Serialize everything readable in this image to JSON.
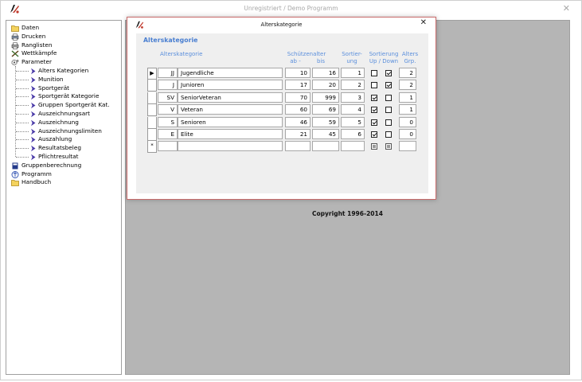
{
  "app": {
    "title": "Unregistriert  /  Demo Programm",
    "close_glyph": "✕"
  },
  "tree": {
    "items": [
      {
        "label": "Daten",
        "icon": "folder-icon",
        "level": 0
      },
      {
        "label": "Drucken",
        "icon": "print-icon",
        "level": 0
      },
      {
        "label": "Ranglisten",
        "icon": "printer-icon",
        "level": 0
      },
      {
        "label": "Wettkämpfe",
        "icon": "crossed-rifles-icon",
        "level": 0
      },
      {
        "label": "Parameter",
        "icon": "gears-icon",
        "level": 0
      },
      {
        "label": "Alters Kategorien",
        "icon": "arrow-icon",
        "level": 1
      },
      {
        "label": "Munition",
        "icon": "arrow-icon",
        "level": 1
      },
      {
        "label": "Sportgerät",
        "icon": "arrow-icon",
        "level": 1
      },
      {
        "label": "Sportgerät Kategorie",
        "icon": "arrow-icon",
        "level": 1
      },
      {
        "label": "Gruppen Sportgerät Kat.",
        "icon": "arrow-icon",
        "level": 1
      },
      {
        "label": "Auszeichnungsart",
        "icon": "arrow-icon",
        "level": 1
      },
      {
        "label": "Auszeichnung",
        "icon": "arrow-icon",
        "level": 1
      },
      {
        "label": "Auszeichnungslimiten",
        "icon": "arrow-icon",
        "level": 1
      },
      {
        "label": "Auszahlung",
        "icon": "arrow-icon",
        "level": 1
      },
      {
        "label": "Resultatsbeleg",
        "icon": "arrow-icon",
        "level": 1
      },
      {
        "label": "Pflichtresultat",
        "icon": "arrow-icon",
        "level": 1
      },
      {
        "label": "Gruppenberechnung",
        "icon": "book-icon",
        "level": 0
      },
      {
        "label": "Programm",
        "icon": "info-icon",
        "level": 0
      },
      {
        "label": "Handbuch",
        "icon": "folder-icon",
        "level": 0
      }
    ]
  },
  "workspace": {
    "copyright": "Copyright  1996-2014"
  },
  "dialog": {
    "title": "Alterskategorie",
    "close_glyph": "✕",
    "section_title": "Alterskategorie",
    "headers": {
      "kategorie": "Alterskategorie",
      "schuetzenalter_line1": "Schützenalter",
      "ab": "ab  -",
      "bis": "bis",
      "sortierung_line1": "Sortier-",
      "sortierung_line2": "ung",
      "updown_line1": "Sortierung",
      "updown_line2": "Up / Down",
      "grp_line1": "Alters",
      "grp_line2": "Grp."
    },
    "current_row_marker": "▶",
    "new_row_marker": "*",
    "rows": [
      {
        "code": "JJ",
        "name": "Jugendliche",
        "ab": "10",
        "bis": "16",
        "sort": "1",
        "up": false,
        "down": true,
        "grp": "2"
      },
      {
        "code": "J",
        "name": "Junioren",
        "ab": "17",
        "bis": "20",
        "sort": "2",
        "up": false,
        "down": true,
        "grp": "2"
      },
      {
        "code": "SV",
        "name": "SeniorVeteran",
        "ab": "70",
        "bis": "999",
        "sort": "3",
        "up": true,
        "down": false,
        "grp": "1"
      },
      {
        "code": "V",
        "name": "Veteran",
        "ab": "60",
        "bis": "69",
        "sort": "4",
        "up": true,
        "down": false,
        "grp": "1"
      },
      {
        "code": "S",
        "name": "Senioren",
        "ab": "46",
        "bis": "59",
        "sort": "5",
        "up": true,
        "down": false,
        "grp": "0"
      },
      {
        "code": "E",
        "name": "Elite",
        "ab": "21",
        "bis": "45",
        "sort": "6",
        "up": true,
        "down": false,
        "grp": "0"
      }
    ]
  }
}
